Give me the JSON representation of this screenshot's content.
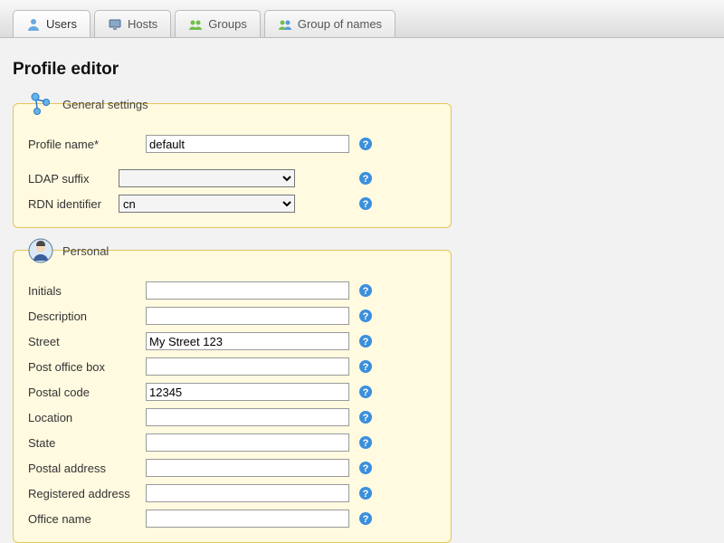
{
  "tabs": {
    "users": {
      "label": "Users"
    },
    "hosts": {
      "label": "Hosts"
    },
    "groups": {
      "label": "Groups"
    },
    "names": {
      "label": "Group of names"
    }
  },
  "page_title": "Profile editor",
  "general": {
    "legend": "General settings",
    "profile_name_label": "Profile name*",
    "profile_name_value": "default",
    "ldap_suffix_label": "LDAP suffix",
    "ldap_suffix_value": "",
    "rdn_label": "RDN identifier",
    "rdn_value": "cn"
  },
  "personal": {
    "legend": "Personal",
    "fields": {
      "initials": {
        "label": "Initials",
        "value": ""
      },
      "description": {
        "label": "Description",
        "value": ""
      },
      "street": {
        "label": "Street",
        "value": "My Street 123"
      },
      "po_box": {
        "label": "Post office box",
        "value": ""
      },
      "postal_code": {
        "label": "Postal code",
        "value": "12345"
      },
      "location": {
        "label": "Location",
        "value": ""
      },
      "state": {
        "label": "State",
        "value": ""
      },
      "postal_address": {
        "label": "Postal address",
        "value": ""
      },
      "registered_address": {
        "label": "Registered address",
        "value": ""
      },
      "office_name": {
        "label": "Office name",
        "value": ""
      }
    }
  }
}
